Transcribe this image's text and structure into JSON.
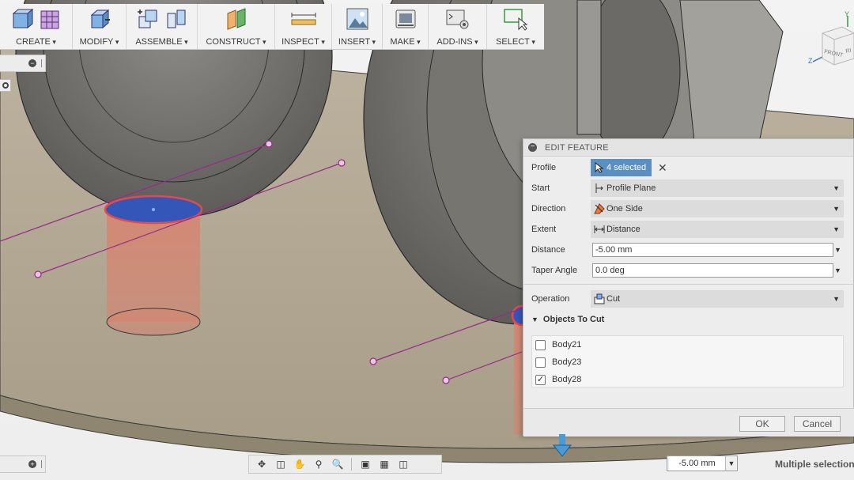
{
  "toolbar": {
    "groups": [
      {
        "label": "CREATE",
        "icons": [
          "extrude-box-icon",
          "mesh-cube-icon"
        ]
      },
      {
        "label": "MODIFY",
        "icons": [
          "press-pull-icon"
        ]
      },
      {
        "label": "ASSEMBLE",
        "icons": [
          "new-component-icon",
          "joint-icon"
        ]
      },
      {
        "label": "CONSTRUCT",
        "icons": [
          "construction-plane-icon"
        ]
      },
      {
        "label": "INSPECT",
        "icons": [
          "measure-ruler-icon"
        ]
      },
      {
        "label": "INSERT",
        "icons": [
          "insert-image-icon"
        ]
      },
      {
        "label": "MAKE",
        "icons": [
          "print-3d-icon"
        ]
      },
      {
        "label": "ADD-INS",
        "icons": [
          "scripts-gear-icon"
        ]
      },
      {
        "label": "SELECT",
        "icons": [
          "select-window-icon"
        ]
      }
    ]
  },
  "dialog": {
    "title": "EDIT FEATURE",
    "profile": {
      "label": "Profile",
      "value": "4 selected"
    },
    "start": {
      "label": "Start",
      "value": "Profile Plane"
    },
    "direction": {
      "label": "Direction",
      "value": "One Side"
    },
    "extent": {
      "label": "Extent",
      "value": "Distance"
    },
    "distance": {
      "label": "Distance",
      "value": "-5.00 mm"
    },
    "taper_angle": {
      "label": "Taper Angle",
      "value": "0.0 deg"
    },
    "operation": {
      "label": "Operation",
      "value": "Cut"
    },
    "objects_to_cut": {
      "title": "Objects To Cut",
      "bodies": [
        {
          "name": "Body21",
          "checked": false
        },
        {
          "name": "Body23",
          "checked": false
        },
        {
          "name": "Body28",
          "checked": true
        }
      ]
    },
    "ok_label": "OK",
    "cancel_label": "Cancel"
  },
  "view_cube": {
    "front_label": "FRONT",
    "right_label": "RI",
    "axis_y": "Y",
    "axis_z": "Z"
  },
  "status": {
    "dimension_value": "-5.00 mm",
    "message": "Multiple selections"
  },
  "colors": {
    "accent": "#5a8fc3",
    "profile_blue": "#3456b8",
    "cut_preview": "#d9826e",
    "sketch_line": "#9a2a8a"
  }
}
